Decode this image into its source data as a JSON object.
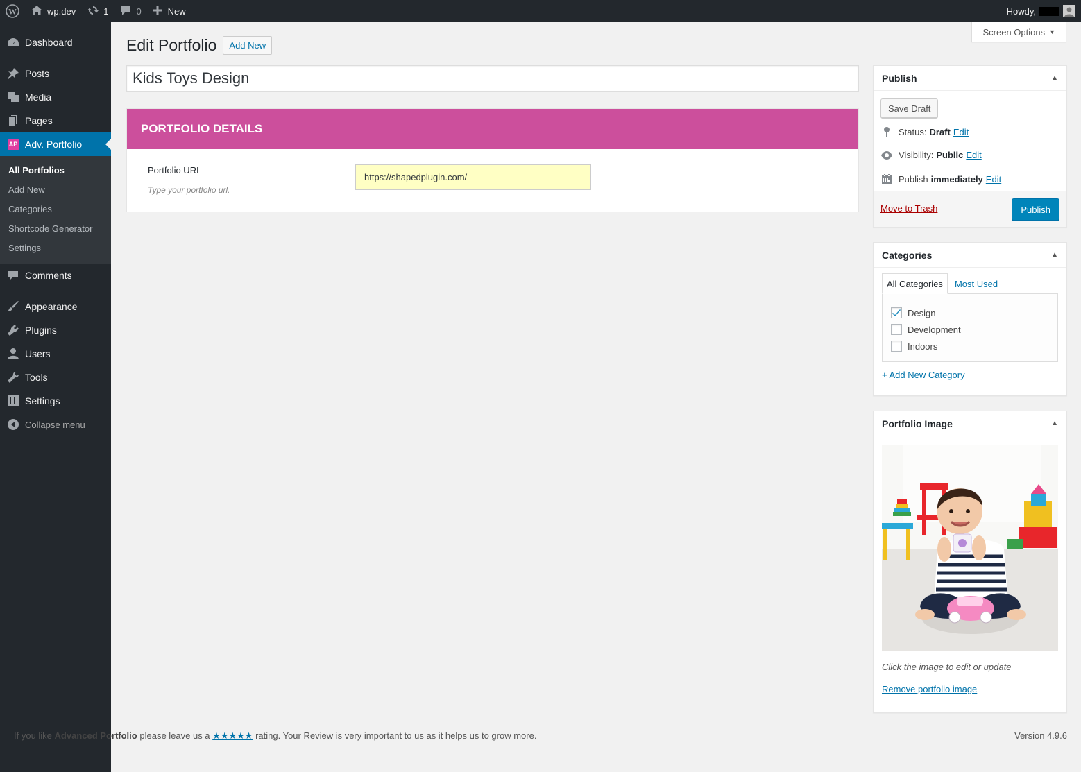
{
  "adminbar": {
    "site_name": "wp.dev",
    "updates_count": "1",
    "comments_count": "0",
    "new_label": "New",
    "howdy": "Howdy,"
  },
  "sidebar": {
    "items": [
      {
        "label": "Dashboard",
        "icon": "dashboard-icon"
      },
      {
        "label": "Posts",
        "icon": "pin-icon"
      },
      {
        "label": "Media",
        "icon": "media-icon"
      },
      {
        "label": "Pages",
        "icon": "pages-icon"
      },
      {
        "label": "Adv. Portfolio",
        "icon": "ap-badge",
        "badge": "AP"
      },
      {
        "label": "Comments",
        "icon": "comment-icon"
      },
      {
        "label": "Appearance",
        "icon": "paintbrush-icon"
      },
      {
        "label": "Plugins",
        "icon": "plugin-icon"
      },
      {
        "label": "Users",
        "icon": "user-icon"
      },
      {
        "label": "Tools",
        "icon": "wrench-icon"
      },
      {
        "label": "Settings",
        "icon": "settings-icon"
      }
    ],
    "submenu": [
      "All Portfolios",
      "Add New",
      "Categories",
      "Shortcode Generator",
      "Settings"
    ],
    "collapse": "Collapse menu"
  },
  "screen_options": "Screen Options",
  "page": {
    "title": "Edit Portfolio",
    "add_new": "Add New",
    "post_title": "Kids Toys Design"
  },
  "details": {
    "heading": "PORTFOLIO DETAILS",
    "url_label": "Portfolio URL",
    "url_desc": "Type your portfolio url.",
    "url_value": "https://shapedplugin.com/"
  },
  "publish": {
    "title": "Publish",
    "save_draft": "Save Draft",
    "status_label": "Status:",
    "status_value": "Draft",
    "visibility_label": "Visibility:",
    "visibility_value": "Public",
    "publish_label": "Publish",
    "publish_value": "immediately",
    "edit": "Edit",
    "trash": "Move to Trash",
    "publish_button": "Publish"
  },
  "categories": {
    "title": "Categories",
    "tab_all": "All Categories",
    "tab_most_used": "Most Used",
    "items": [
      {
        "label": "Design",
        "checked": true
      },
      {
        "label": "Development",
        "checked": false
      },
      {
        "label": "Indoors",
        "checked": false
      }
    ],
    "add_new": "+ Add New Category"
  },
  "portfolio_image": {
    "title": "Portfolio Image",
    "desc": "Click the image to edit or update",
    "remove": "Remove portfolio image"
  },
  "footer": {
    "text_before": "If you like",
    "plugin_name": "Advanced Portfolio",
    "text_mid": "please leave us a",
    "stars": "★★★★★",
    "text_after": "rating. Your Review is very important to us as it helps us to grow more.",
    "version": "Version 4.9.6"
  },
  "colors": {
    "accent": "#0073aa",
    "portfolio_header": "#cc4f9c",
    "adminbar": "#23282d"
  }
}
